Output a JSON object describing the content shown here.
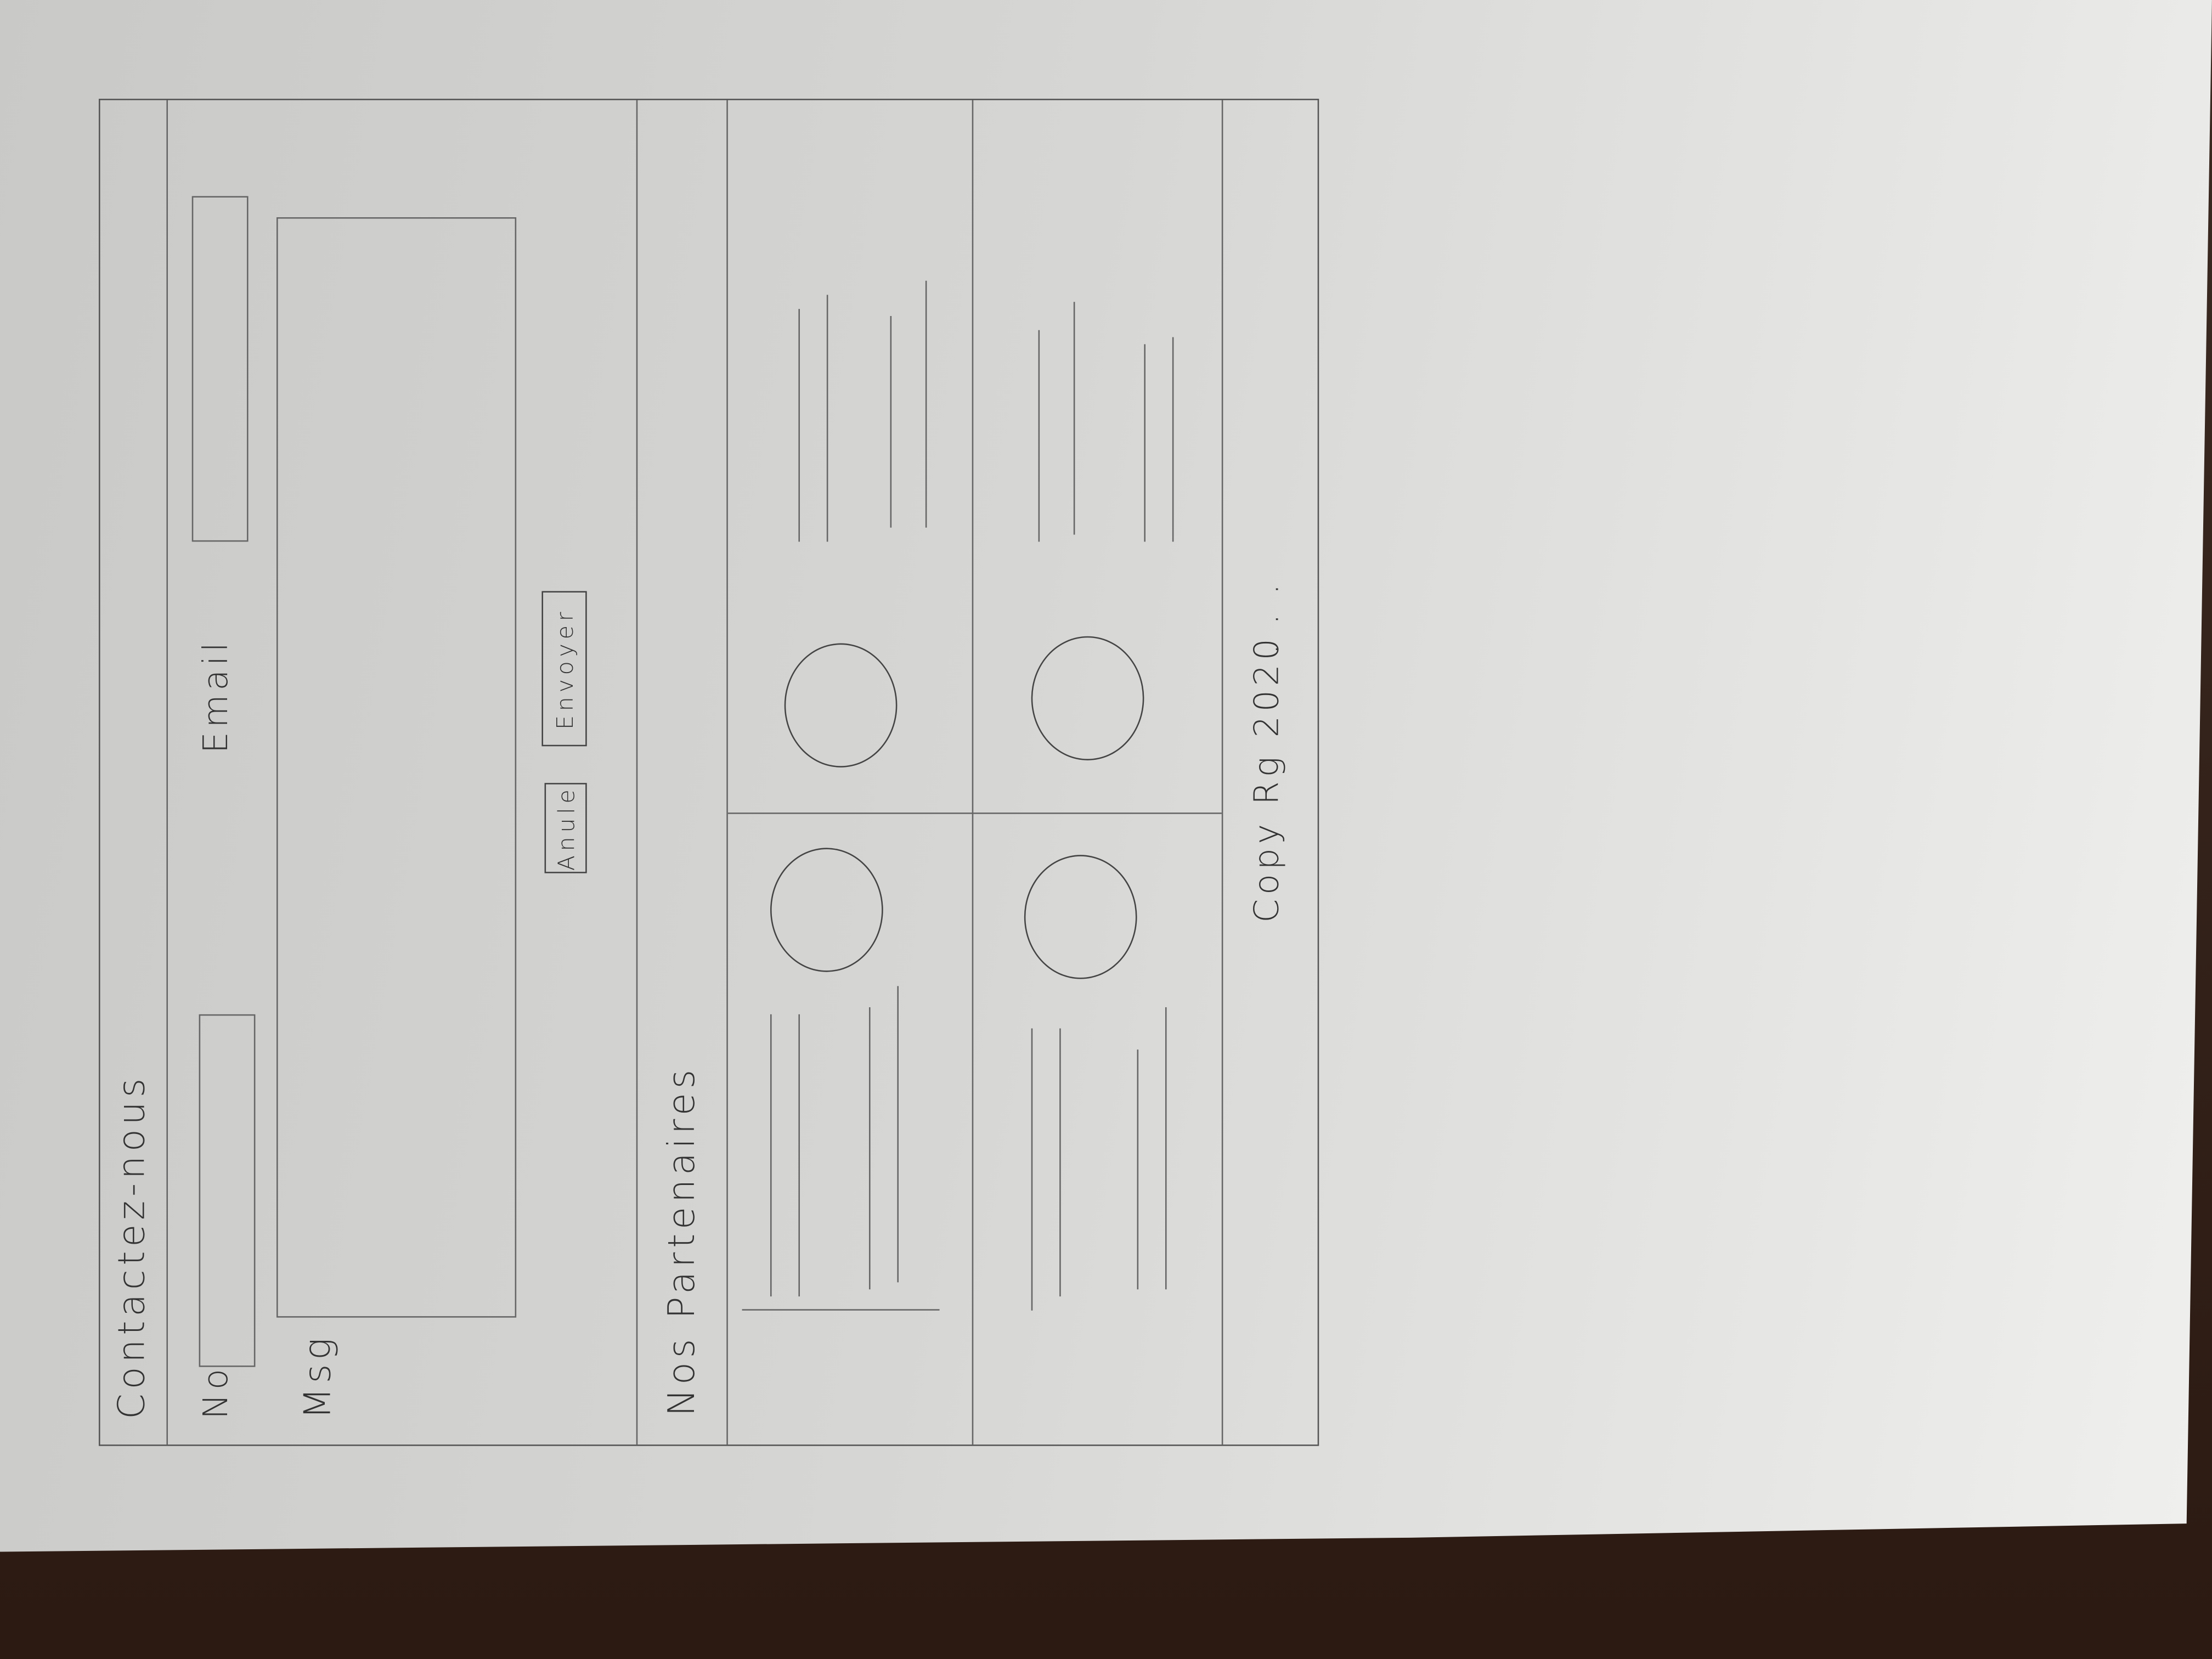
{
  "contact": {
    "title": "Contactez-nous",
    "name_label": "No",
    "email_label": "Email",
    "message_label": "Msg",
    "name_value": "",
    "email_value": "",
    "message_value": "",
    "cancel_label": "Anule",
    "send_label": "Envoyer"
  },
  "partners": {
    "title": "Nos Partenaires",
    "items": [
      {
        "image": "circle-image"
      },
      {
        "image": "circle-image"
      },
      {
        "image": "circle-image"
      },
      {
        "image": "circle-image"
      }
    ]
  },
  "footer": {
    "copyright": "Copy Rg 2020",
    "ellipsis": ". . ."
  },
  "colors": {
    "paper": "#d6d6d4",
    "pencil": "#555555",
    "table": "#3a2218"
  }
}
